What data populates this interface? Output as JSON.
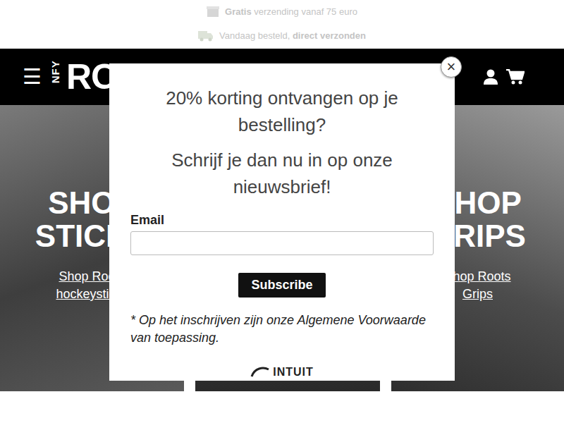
{
  "topbar": [
    {
      "parts": [
        {
          "text": "Gratis",
          "bold": true
        },
        {
          "text": " verzending vanaf 75 euro",
          "bold": false
        }
      ]
    },
    {
      "parts": [
        {
          "text": "Vandaag besteld, ",
          "bold": false
        },
        {
          "text": "direct verzonden",
          "bold": true
        }
      ]
    }
  ],
  "header": {
    "menu": "☰",
    "logo_small": "NFY",
    "logo_main": "ROOTS"
  },
  "tiles": [
    {
      "heading": "SHOP STICKS",
      "link": "Shop Roots hockeysticks"
    },
    {
      "heading": "SHOP GRIPS",
      "link": "Shop Roots Grips"
    }
  ],
  "popup": {
    "close": "×",
    "title": "20% korting ontvangen op je bestelling?",
    "subtitle": "Schrijf je dan nu in op onze nieuwsbrief!",
    "email_label": "Email",
    "subscribe": "Subscribe",
    "terms": "* Op het inschrijven zijn onze Algemene Voorwaarde van toepassing.",
    "brand": "INTUIT"
  }
}
